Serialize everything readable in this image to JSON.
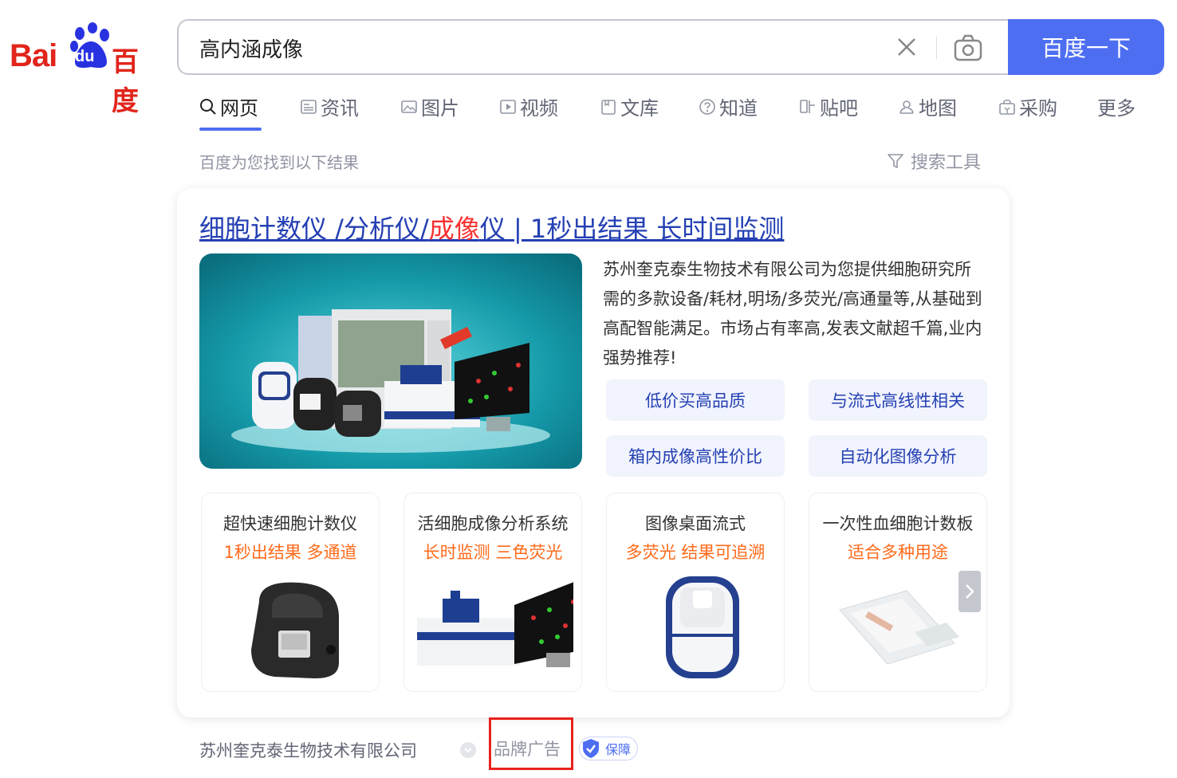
{
  "logo": {
    "latin": "Bai",
    "du": "du",
    "chinese": "百度"
  },
  "search": {
    "query": "高内涵成像",
    "button_label": "百度一下"
  },
  "tabs": [
    {
      "label": "网页",
      "icon": "search-icon"
    },
    {
      "label": "资讯",
      "icon": "news-icon"
    },
    {
      "label": "图片",
      "icon": "image-icon"
    },
    {
      "label": "视频",
      "icon": "video-icon"
    },
    {
      "label": "文库",
      "icon": "doc-icon"
    },
    {
      "label": "知道",
      "icon": "question-icon"
    },
    {
      "label": "贴吧",
      "icon": "tieba-icon"
    },
    {
      "label": "地图",
      "icon": "map-icon"
    },
    {
      "label": "采购",
      "icon": "shop-icon"
    },
    {
      "label": "更多",
      "icon": ""
    }
  ],
  "results": {
    "count_text": "百度为您找到以下结果",
    "tools_label": "搜索工具"
  },
  "ad": {
    "title_part1": "细胞计数仪 /分析仪/",
    "title_highlight": "成像",
    "title_part2": "仪 | 1秒出结果 长时间监测",
    "description": "苏州奎克泰生物技术有限公司为您提供细胞研究所需的多款设备/耗材,明场/多荧光/高通量等,从基础到高配智能满足。市场占有率高,发表文献超千篇,业内强势推荐!",
    "chips": [
      "低价买高品质",
      "与流式高线性相关",
      "箱内成像高性价比",
      "自动化图像分析"
    ],
    "products": [
      {
        "name": "超快速细胞计数仪",
        "sub": "1秒出结果 多通道"
      },
      {
        "name": "活细胞成像分析系统",
        "sub": "长时监测 三色荧光"
      },
      {
        "name": "图像桌面流式",
        "sub": "多荧光 结果可追溯"
      },
      {
        "name": "一次性血细胞计数板",
        "sub": "适合多种用途"
      }
    ]
  },
  "footer": {
    "company": "苏州奎克泰生物技术有限公司",
    "brand_ad": "品牌广告",
    "guarantee": "保障"
  },
  "colors": {
    "brand_blue": "#4e6ef2",
    "link_blue": "#2440b3",
    "highlight_red": "#f73131",
    "orange": "#ff6a1a",
    "annotation_red": "#e8221d"
  }
}
